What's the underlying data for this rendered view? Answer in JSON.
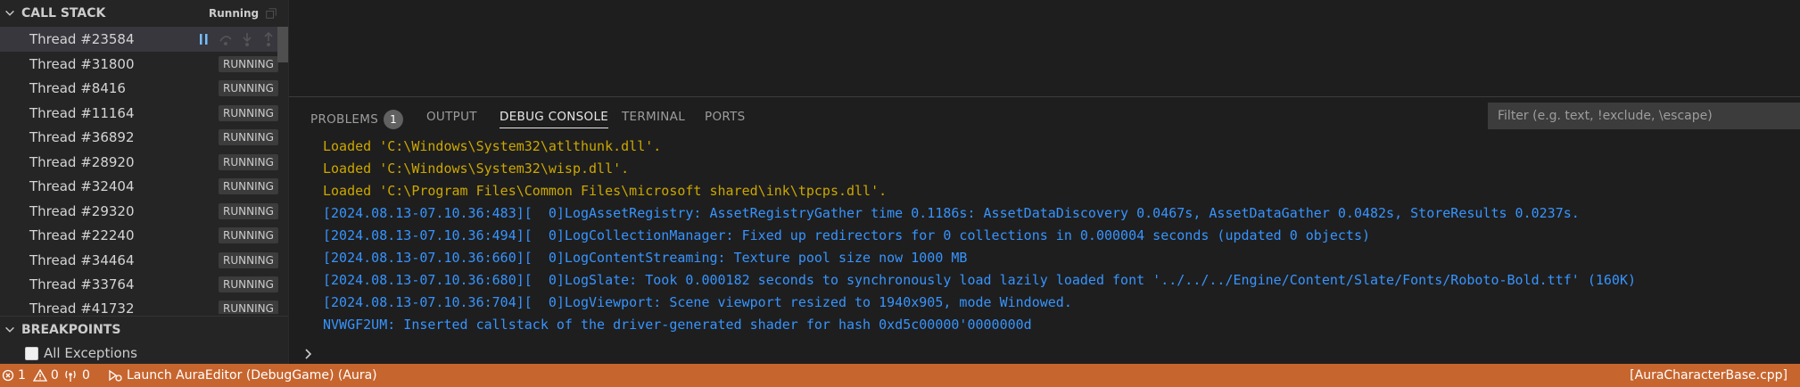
{
  "call_stack": {
    "title": "CALL STACK",
    "status": "Running",
    "threads": [
      {
        "label": "Thread #23584",
        "state": ""
      },
      {
        "label": "Thread #31800",
        "state": "RUNNING"
      },
      {
        "label": "Thread #8416",
        "state": "RUNNING"
      },
      {
        "label": "Thread #11164",
        "state": "RUNNING"
      },
      {
        "label": "Thread #36892",
        "state": "RUNNING"
      },
      {
        "label": "Thread #28920",
        "state": "RUNNING"
      },
      {
        "label": "Thread #32404",
        "state": "RUNNING"
      },
      {
        "label": "Thread #29320",
        "state": "RUNNING"
      },
      {
        "label": "Thread #22240",
        "state": "RUNNING"
      },
      {
        "label": "Thread #34464",
        "state": "RUNNING"
      },
      {
        "label": "Thread #33764",
        "state": "RUNNING"
      },
      {
        "label": "Thread #41732",
        "state": "RUNNING"
      }
    ]
  },
  "breakpoints": {
    "title": "BREAKPOINTS",
    "all_exceptions": "All Exceptions"
  },
  "panel": {
    "tabs": {
      "problems": "PROBLEMS",
      "problems_count": "1",
      "output": "OUTPUT",
      "debug_console": "DEBUG CONSOLE",
      "terminal": "TERMINAL",
      "ports": "PORTS"
    },
    "filter_placeholder": "Filter (e.g. text, !exclude, \\escape)",
    "lines": [
      {
        "text": "Loaded 'C:\\Windows\\System32\\atlthunk.dll'.",
        "color": "yellow"
      },
      {
        "text": "Loaded 'C:\\Windows\\System32\\wisp.dll'.",
        "color": "yellow"
      },
      {
        "text": "Loaded 'C:\\Program Files\\Common Files\\microsoft shared\\ink\\tpcps.dll'.",
        "color": "yellow"
      },
      {
        "text": "[2024.08.13-07.10.36:483][  0]LogAssetRegistry: AssetRegistryGather time 0.1186s: AssetDataDiscovery 0.0467s, AssetDataGather 0.0482s, StoreResults 0.0237s.",
        "color": "blue"
      },
      {
        "text": "[2024.08.13-07.10.36:494][  0]LogCollectionManager: Fixed up redirectors for 0 collections in 0.000004 seconds (updated 0 objects)",
        "color": "blue"
      },
      {
        "text": "[2024.08.13-07.10.36:660][  0]LogContentStreaming: Texture pool size now 1000 MB",
        "color": "blue"
      },
      {
        "text": "[2024.08.13-07.10.36:680][  0]LogSlate: Took 0.000182 seconds to synchronously load lazily loaded font '../../../Engine/Content/Slate/Fonts/Roboto-Bold.ttf' (160K)",
        "color": "blue"
      },
      {
        "text": "[2024.08.13-07.10.36:704][  0]LogViewport: Scene viewport resized to 1940x905, mode Windowed.",
        "color": "blue"
      },
      {
        "text": "NVWGF2UM: Inserted callstack of the driver-generated shader for hash 0xd5c00000'0000000d",
        "color": "blue"
      }
    ]
  },
  "statusbar": {
    "errors": "1",
    "warnings": "0",
    "ports": "0",
    "launch": "Launch AuraEditor (DebugGame) (Aura)",
    "file": "[AuraCharacterBase.cpp]"
  }
}
